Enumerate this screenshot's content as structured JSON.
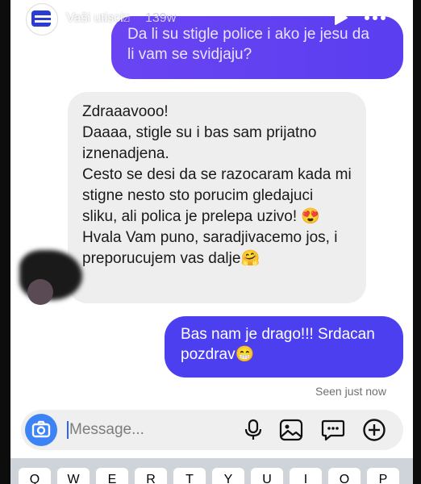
{
  "header": {
    "name": "Vaši utisci",
    "name_suffix_glyph": "⍁",
    "time": "139w"
  },
  "messages": [
    {
      "side": "out",
      "lines": [
        "Da li su stigle police i ako je jesu da",
        "li vam se svidjaju?"
      ]
    },
    {
      "side": "in",
      "paragraphs": [
        "Zdraaavooo!",
        "Daaaa, stigle su i bas sam prijatno iznenadjena.",
        "Cesto se desi da se razocaram kada mi stigne nesto sto porucim gledajuci sliku, ali polica je prelepa uzivo! ",
        "Hvala Vam puno, saradjivacemo jos, i preporucujem vas dalje"
      ],
      "emoji_love": "😍",
      "emoji_hug": "🤗"
    },
    {
      "side": "out",
      "lines": [
        "Bas nam je drago!!! Srdacan",
        "pozdrav"
      ],
      "emoji": "😁"
    }
  ],
  "status": {
    "seen": "Seen just now"
  },
  "composer": {
    "placeholder": "Message..."
  },
  "keyboard": {
    "keys": [
      "Q",
      "W",
      "E",
      "R",
      "T",
      "Y",
      "U",
      "I",
      "O",
      "P"
    ]
  },
  "colors": {
    "outgoing_bubble": "#5b3ef0",
    "incoming_bubble": "#eeeeee",
    "camera_button": "#3c83f5"
  },
  "icons": [
    "play-icon",
    "more-icon",
    "camera-icon",
    "microphone-icon",
    "gallery-icon",
    "sticker-icon",
    "plus-icon"
  ]
}
